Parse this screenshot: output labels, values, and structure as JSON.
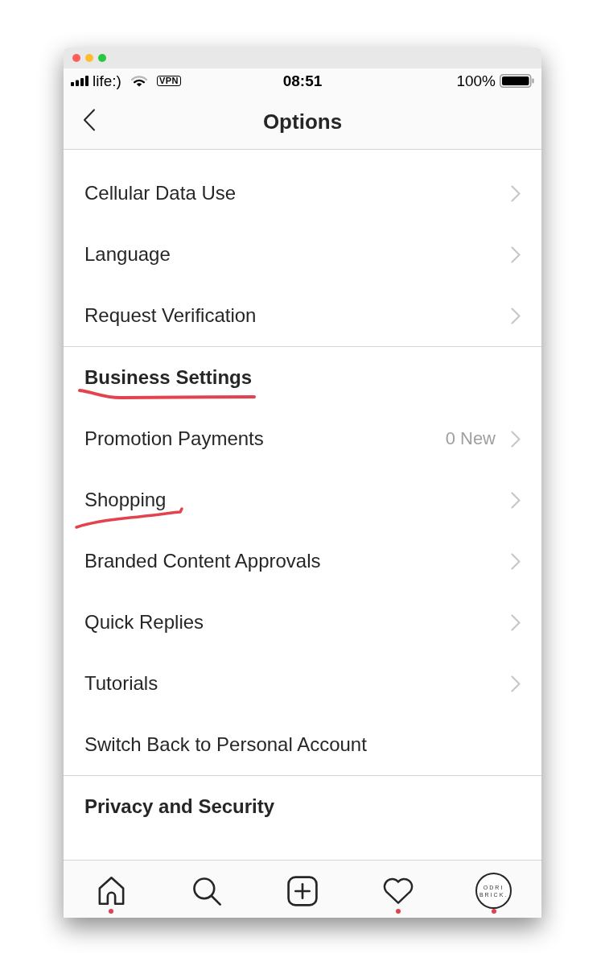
{
  "status_bar": {
    "carrier": "life:)",
    "vpn": "VPN",
    "time": "08:51",
    "battery": "100%"
  },
  "nav": {
    "title": "Options"
  },
  "sections": [
    {
      "items": [
        {
          "label": "Cellular Data Use",
          "chevron": true,
          "underlined": false
        },
        {
          "label": "Language",
          "chevron": true,
          "underlined": false
        },
        {
          "label": "Request Verification",
          "chevron": true,
          "underlined": false
        }
      ]
    },
    {
      "title": "Business Settings",
      "title_underlined": true,
      "items": [
        {
          "label": "Promotion Payments",
          "detail": "0 New",
          "chevron": true,
          "underlined": false
        },
        {
          "label": "Shopping",
          "chevron": true,
          "underlined": true
        },
        {
          "label": "Branded Content Approvals",
          "chevron": true,
          "underlined": false
        },
        {
          "label": "Quick Replies",
          "chevron": true,
          "underlined": false
        },
        {
          "label": "Tutorials",
          "chevron": true,
          "underlined": false
        },
        {
          "label": "Switch Back to Personal Account",
          "chevron": false,
          "underlined": false
        }
      ]
    },
    {
      "title": "Privacy and Security",
      "title_underlined": false
    }
  ],
  "tab_bar": {
    "tabs": [
      {
        "kind": "home",
        "badge": true
      },
      {
        "kind": "search",
        "badge": false
      },
      {
        "kind": "create",
        "badge": false
      },
      {
        "kind": "activity",
        "badge": true
      },
      {
        "kind": "profile",
        "badge": true,
        "avatar_text": "ODRI BRICK."
      }
    ]
  }
}
